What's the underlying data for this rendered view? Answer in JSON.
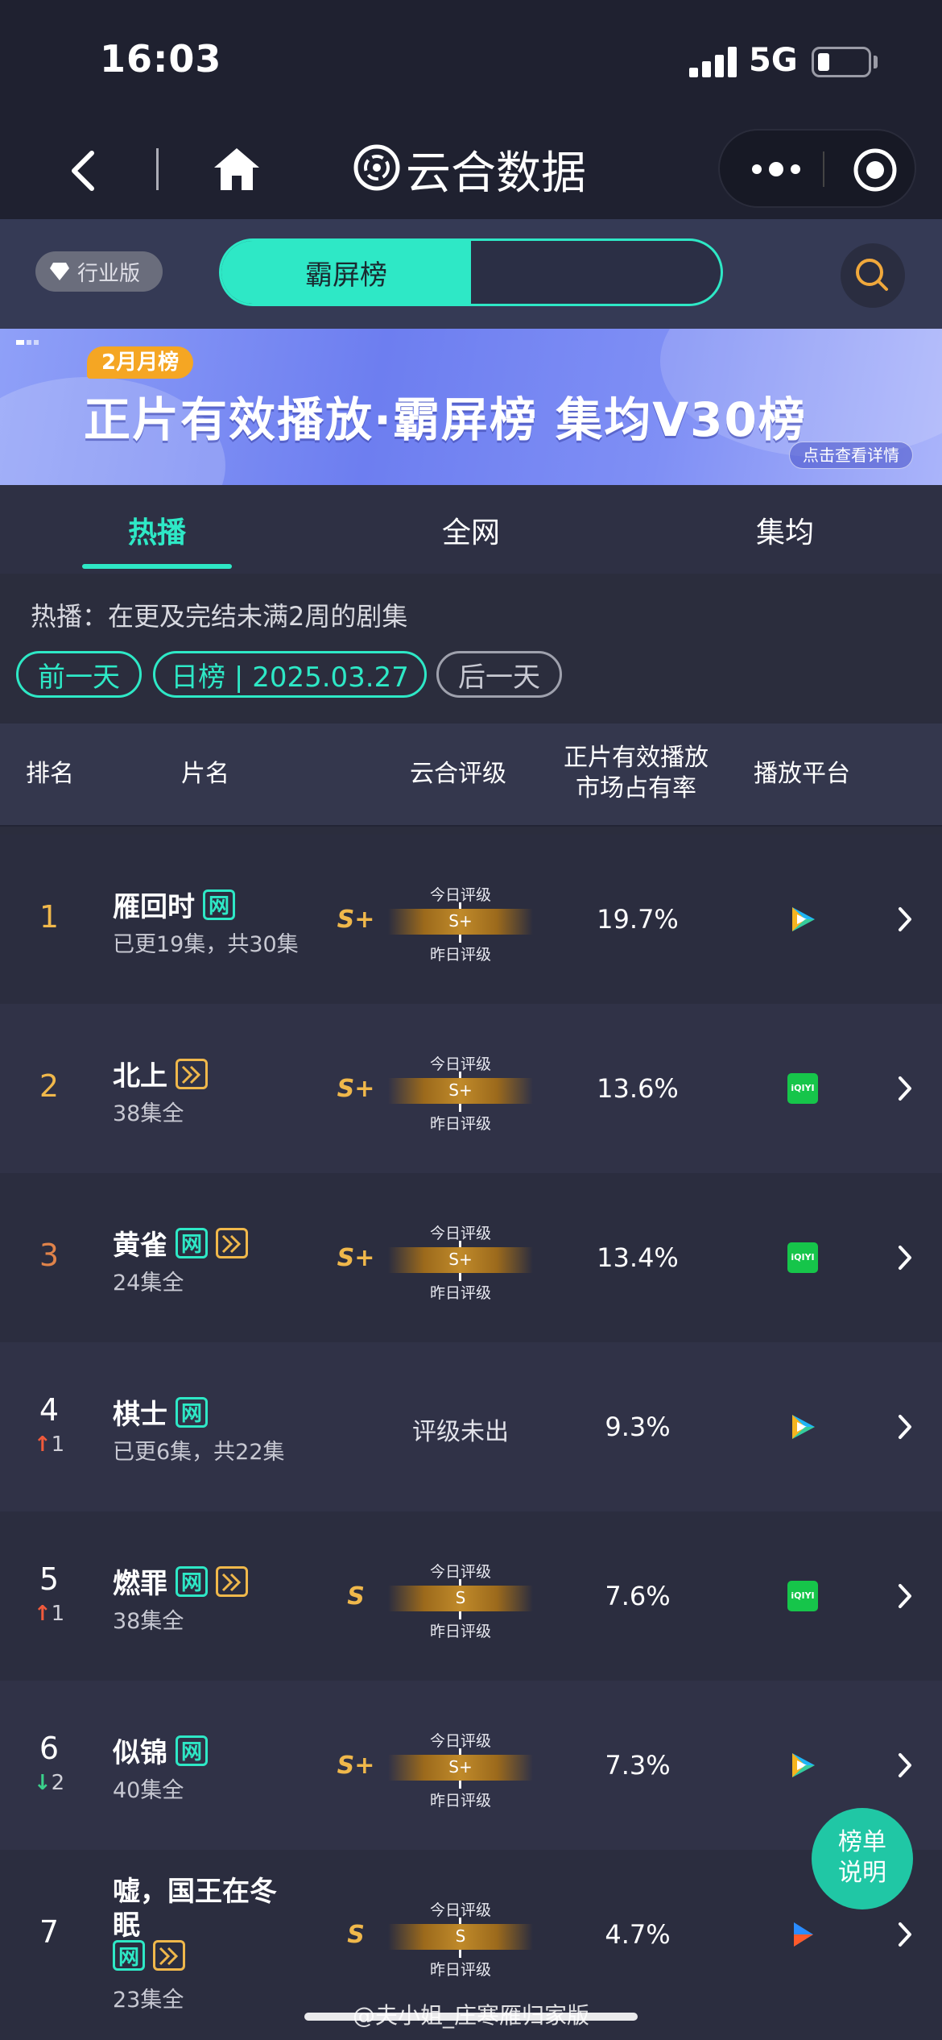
{
  "status": {
    "time": "16:03",
    "network": "5G"
  },
  "nav": {
    "title": "云合数据",
    "icons": [
      "back-icon",
      "home-icon",
      "yunhe-logo-icon",
      "more-icon",
      "target-icon"
    ]
  },
  "header": {
    "edition": "行业版",
    "segment_active": "霸屏榜",
    "segment_inactive": "",
    "search_icon": "search-icon"
  },
  "banner": {
    "tag": "2月月榜",
    "title": "正片有效播放·霸屏榜 集均V30榜",
    "link": "点击查看详情"
  },
  "tabs": [
    {
      "label": "热播",
      "active": true
    },
    {
      "label": "全网",
      "active": false
    },
    {
      "label": "集均",
      "active": false
    }
  ],
  "info": {
    "description": "热播：在更及完结未满2周的剧集",
    "prev_day": "前一天",
    "date_label": "日榜 | 2025.03.27",
    "next_day": "后一天"
  },
  "table": {
    "headers": {
      "rank": "排名",
      "title": "片名",
      "rating": "云合评级",
      "share_line1": "正片有效播放",
      "share_line2": "市场占有率",
      "platform": "播放平台"
    },
    "today_label": "今日评级",
    "yesterday_label": "昨日评级",
    "rows": [
      {
        "rank": "1",
        "title": "雁回时",
        "badges": [
          "网"
        ],
        "subtitle": "已更19集，共30集",
        "grade": "S+",
        "bar_grade": "S+",
        "share": "19.7%",
        "platform": "tencent-video"
      },
      {
        "rank": "2",
        "title": "北上",
        "badges": [
          "ff"
        ],
        "subtitle": "38集全",
        "grade": "S+",
        "bar_grade": "S+",
        "share": "13.6%",
        "platform": "iqiyi"
      },
      {
        "rank": "3",
        "title": "黄雀",
        "badges": [
          "网",
          "ff"
        ],
        "subtitle": "24集全",
        "grade": "S+",
        "bar_grade": "S+",
        "share": "13.4%",
        "platform": "iqiyi"
      },
      {
        "rank": "4",
        "change": "1",
        "direction": "up",
        "title": "棋士",
        "badges": [
          "网"
        ],
        "subtitle": "已更6集，共22集",
        "grade": "",
        "no_grade": "评级未出",
        "share": "9.3%",
        "platform": "tencent-video"
      },
      {
        "rank": "5",
        "change": "1",
        "direction": "up",
        "title": "燃罪",
        "badges": [
          "网",
          "ff"
        ],
        "subtitle": "38集全",
        "grade": "S",
        "bar_grade": "S",
        "share": "7.6%",
        "platform": "iqiyi"
      },
      {
        "rank": "6",
        "change": "2",
        "direction": "down",
        "title": "似锦",
        "badges": [
          "网"
        ],
        "subtitle": "40集全",
        "grade": "S+",
        "bar_grade": "S+",
        "share": "7.3%",
        "platform": "tencent-video"
      },
      {
        "rank": "7",
        "title_line1": "嘘，国王在冬",
        "title_line2": "眠",
        "badges": [
          "网",
          "ff"
        ],
        "subtitle": "23集全",
        "grade": "S",
        "bar_grade": "S",
        "share": "4.7%",
        "platform": "youku"
      }
    ]
  },
  "help_button": {
    "line1": "榜单",
    "line2": "说明"
  },
  "footer_watermark": "@夫小姐_庄寒雁归家版",
  "colors": {
    "accent": "#2ee8c6",
    "gold": "#f0b84b",
    "background": "#2b2d3d"
  }
}
